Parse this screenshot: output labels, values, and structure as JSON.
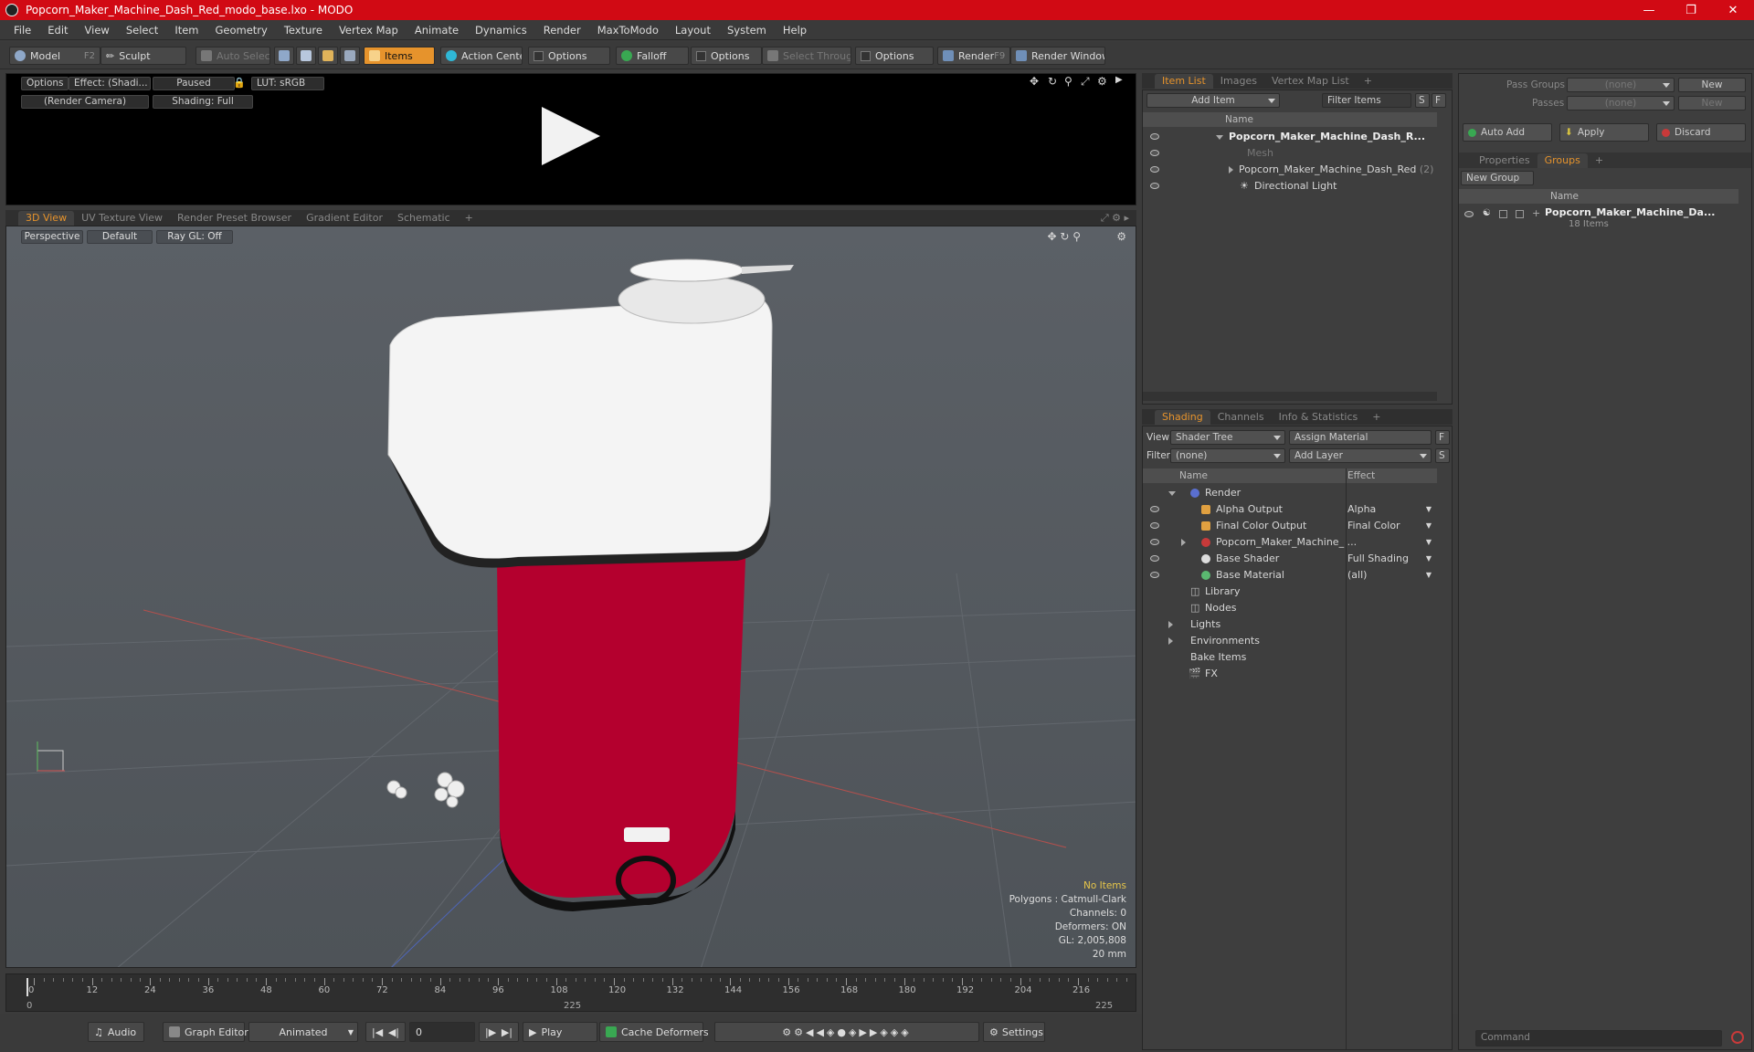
{
  "window": {
    "title": "Popcorn_Maker_Machine_Dash_Red_modo_base.lxo - MODO"
  },
  "menu": [
    "File",
    "Edit",
    "View",
    "Select",
    "Item",
    "Geometry",
    "Texture",
    "Vertex Map",
    "Animate",
    "Dynamics",
    "Render",
    "MaxToModo",
    "Layout",
    "System",
    "Help"
  ],
  "toolbar": {
    "model": "Model",
    "model_key": "F2",
    "sculpt": "Sculpt",
    "auto_select": "Auto Select",
    "items": "Items",
    "action_center": "Action Center",
    "options1": "Options",
    "falloff": "Falloff",
    "options2": "Options",
    "select_through": "Select Through",
    "options3": "Options",
    "render": "Render",
    "render_key": "F9",
    "render_window": "Render Window"
  },
  "preview": {
    "options": "Options",
    "effect": "Effect: (Shadi...",
    "paused": "Paused",
    "lut": "LUT: sRGB",
    "camera": "(Render Camera)",
    "shading": "Shading: Full"
  },
  "view_tabs": [
    "3D View",
    "UV Texture View",
    "Render Preset Browser",
    "Gradient Editor",
    "Schematic"
  ],
  "viewport": {
    "perspective": "Perspective",
    "default": "Default",
    "raygl": "Ray GL: Off"
  },
  "stats": {
    "no_items": "No Items",
    "polygons": "Polygons : Catmull-Clark",
    "channels": "Channels: 0",
    "deformers": "Deformers: ON",
    "gl": "GL: 2,005,808",
    "scale": "20 mm"
  },
  "timeline": {
    "ticks": [
      "0",
      "12",
      "24",
      "36",
      "48",
      "60",
      "72",
      "84",
      "96",
      "108",
      "120",
      "132",
      "144",
      "156",
      "168",
      "180",
      "192",
      "204",
      "216"
    ],
    "start": "0",
    "mid": "225",
    "end": "225"
  },
  "bottom": {
    "audio": "Audio",
    "graph_editor": "Graph Editor",
    "animated": "Animated",
    "frame": "0",
    "play": "Play",
    "cache_deformers": "Cache Deformers",
    "settings": "Settings"
  },
  "item_list": {
    "tabs": [
      "Item List",
      "Images",
      "Vertex Map List"
    ],
    "add_item": "Add Item",
    "filter": "Filter Items",
    "s": "S",
    "f": "F",
    "col_name": "Name",
    "rows": [
      {
        "label": "Popcorn_Maker_Machine_Dash_R...",
        "extra": ""
      },
      {
        "label": "Mesh",
        "extra": ""
      },
      {
        "label": "Popcorn_Maker_Machine_Dash_Red",
        "extra": "(2)"
      },
      {
        "label": "Directional Light",
        "extra": ""
      }
    ]
  },
  "shading": {
    "tabs": [
      "Shading",
      "Channels",
      "Info & Statistics"
    ],
    "view_label": "View",
    "view_value": "Shader Tree",
    "assign_material": "Assign Material",
    "f": "F",
    "filter_label": "Filter",
    "filter_value": "(none)",
    "add_layer": "Add Layer",
    "s": "S",
    "col_name": "Name",
    "col_effect": "Effect",
    "rows": [
      {
        "label": "Render",
        "effect": ""
      },
      {
        "label": "Alpha Output",
        "effect": "Alpha"
      },
      {
        "label": "Final Color Output",
        "effect": "Final Color"
      },
      {
        "label": "Popcorn_Maker_Machine_ ...",
        "effect": ""
      },
      {
        "label": "Base Shader",
        "effect": "Full Shading"
      },
      {
        "label": "Base Material",
        "effect": "(all)"
      },
      {
        "label": "Library",
        "effect": ""
      },
      {
        "label": "Nodes",
        "effect": ""
      },
      {
        "label": "Lights",
        "effect": ""
      },
      {
        "label": "Environments",
        "effect": ""
      },
      {
        "label": "Bake Items",
        "effect": ""
      },
      {
        "label": "FX",
        "effect": ""
      }
    ]
  },
  "groups": {
    "pass_groups_label": "Pass Groups",
    "pass_groups_value": "(none)",
    "new": "New",
    "passes_label": "Passes",
    "passes_value": "(none)",
    "new2": "New",
    "auto_add": "Auto Add",
    "apply": "Apply",
    "discard": "Discard",
    "tabs": [
      "Properties",
      "Groups"
    ],
    "new_group": "New Group",
    "col_name": "Name",
    "group_name": "Popcorn_Maker_Machine_Da...",
    "group_count": "18 Items",
    "command_placeholder": "Command"
  },
  "colors": {
    "accent": "#e6932c",
    "title_bar": "#d10a14",
    "body_red": "#b4002e"
  }
}
